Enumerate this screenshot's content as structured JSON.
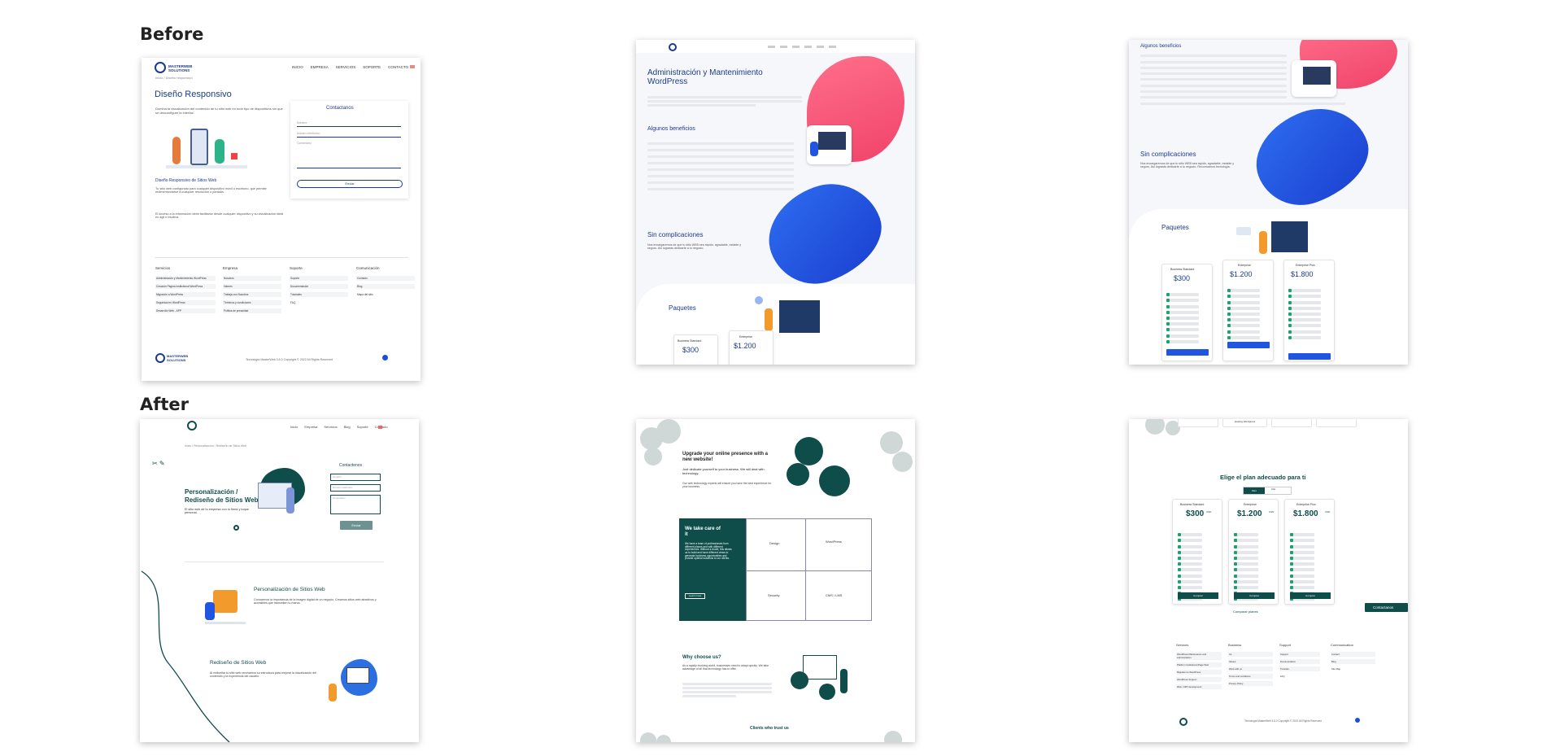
{
  "labels": {
    "before": "Before",
    "after": "After"
  },
  "p1": {
    "nav": [
      "INICIO",
      "EMPRESA",
      "SERVICIOS",
      "SOPORTE",
      "CONTACTO"
    ],
    "logo": "MASTERWEB SOLUTIONS",
    "breadcrumb": "Inicio  /  Diseño responsivo",
    "title": "Diseño Responsivo",
    "intro": "Domina la visualización del contenido de tu sitio web en todo tipo de dispositivos sin que se desconfigure la interfaz.",
    "sub": "Diseño Responsivo de Sitios Web",
    "body1": "Tu sitio web configurado para cualquier dispositivo móvil o escritorio, que permite redimensionarse a cualquier resolución o pantalla.",
    "body2": "El acceso a la información debe facilitarse desde cualquier dispositivo y su visualización ideal en ágil e intuitiva.",
    "form_title": "Contactanos",
    "form_fields": [
      "Nombre",
      "Número telefónico",
      "Comentario"
    ],
    "submit": "Enviar",
    "footer_cols": [
      "Servicios",
      "Empresa",
      "Soporte",
      "Comunicación"
    ],
    "footer_items": [
      [
        "Administración y Mantenimiento WordPress",
        "Creación Página Institutional WordPress",
        "Migración a WordPress",
        "Seguridad en WordPress",
        "Desarrollo Web - APP"
      ],
      [
        "Nosotros",
        "Valores",
        "Trabaja con Nosotros",
        "Términos y condiciones",
        "Política de privacidad"
      ],
      [
        "Soporte",
        "Documentación",
        "Tutoriales",
        "FAQ"
      ],
      [
        "Contacto",
        "Blog",
        "Mapa del sitio"
      ]
    ],
    "copyright": "Tecnología MasterWeb 3.6.0 Copyright © 2022 All Rights Reserved"
  },
  "p2": {
    "title1": "Administración y Mantenimiento",
    "title2": "WordPress",
    "benefits": "Algunos beneficios",
    "simple": "Sin complicaciones",
    "simple_body": "Nos encargaremos de que tu sitio WEB sea rápido, agradable, estable y seguro. Así lograrás dedicarte a tu negocio.",
    "packs": "Paquetes",
    "plans": [
      {
        "name": "Business Standard",
        "price": "$300"
      },
      {
        "name": "Enterprise",
        "price": "$1.200"
      }
    ]
  },
  "p3": {
    "benefits": "Algunos beneficios",
    "simple": "Sin complicaciones",
    "simple_body": "Nos encargaremos de que tu sitio WEB sea rápido, agradable, estable y seguro. Así lograrás dedicarte a tu negocio. Reconocimos tecnología.",
    "packs": "Paquetes",
    "plans": [
      {
        "name": "Business Standard",
        "price": "$300"
      },
      {
        "name": "Enterprise",
        "price": "$1.200"
      },
      {
        "name": "Enterprise Plus",
        "price": "$1.800"
      }
    ],
    "btn": "Comprar"
  },
  "p4": {
    "nav": [
      "Inicio",
      "Empresa",
      "Servicios",
      "Blog",
      "Soporte",
      "Contacto"
    ],
    "breadcrumb": "Inicio  /  Personalización / Rediseño de Sitios Web",
    "title1": "Personalización /",
    "title2": "Rediseño de Sitios Web",
    "intro": "El sitio web de tu empresa con tu firma y toque personal.",
    "form_title": "Contactenos",
    "form_fields": [
      "Nombre",
      "Número telefónico",
      "Comentario"
    ],
    "submit": "Enviar",
    "s1_title": "Personalización de Sitios Web",
    "s1_body": "Conocemos la importancia de la imagen digital de un negocio. Creamos sitios web atractivos y accesibles que transmiten tu marca.",
    "s2_title": "Rediseño de Sitios Web",
    "s2_body": "Al rediseñar tu sitio web renovamos su estructura para mejorar la visualización del contenido y la experiencia del usuario."
  },
  "p5": {
    "hero_title": "Upgrade your online presence with a new website!",
    "hero_sub": "Just dedicate yourself to your business. We will deal with technology.",
    "hero_body": "Our web technology experts will ensure you have the best experience for your business.",
    "care_title": "We take care of it",
    "care_body": "We have a team of professionals from different places and with different experiences. Without a doubt, this allows us to build and have different views to generate business opportunities and provide optimal solutions to our clients.",
    "learn": "Learn more",
    "cells": [
      "Design",
      "WordPress",
      "Security",
      "CMS / LMS"
    ],
    "why_title": "Why choose us?",
    "why_body": "As a rapidly evolving world, businesses need to adapt quickly. We take advantage of all that technology has to offer.",
    "clients": "Clients who trust us"
  },
  "p6": {
    "top_tab": "Hosting Wordpress",
    "title": "Elige el plan adecuado para ti",
    "toggle": [
      "Mes",
      "Año"
    ],
    "plans": [
      {
        "name": "Business Standard",
        "price": "$300",
        "unit": "USD"
      },
      {
        "name": "Enterprise",
        "price": "$1.200",
        "unit": "USD"
      },
      {
        "name": "Enterprise Plus",
        "price": "$1.800",
        "unit": "USD"
      }
    ],
    "btn": "Comprar",
    "compare": "Comparar planes",
    "contact": "Contactanos",
    "footer_cols": [
      "Services",
      "Business",
      "Support",
      "Communication"
    ],
    "footer_items": [
      [
        "WordPress Maintenance and Administration",
        "Platform Institutional Page Web",
        "Migration to WordPress",
        "WordPress Support",
        "Web / APP development"
      ],
      [
        "Us",
        "Values",
        "Work with us",
        "Terms and conditions",
        "Privacy Policy"
      ],
      [
        "Support",
        "Documentation",
        "Tutorials",
        "FAQ"
      ],
      [
        "Contact",
        "Blog",
        "Site Map"
      ]
    ],
    "copyright": "Tecnología MasterWeb 3.6.0 Copyright © 2022 All Rights Reserved"
  },
  "colors": {
    "teal": "#0f4d4a",
    "pink": "#f0436a",
    "blue": "#1f55e0",
    "navy": "#1b3b8a"
  }
}
